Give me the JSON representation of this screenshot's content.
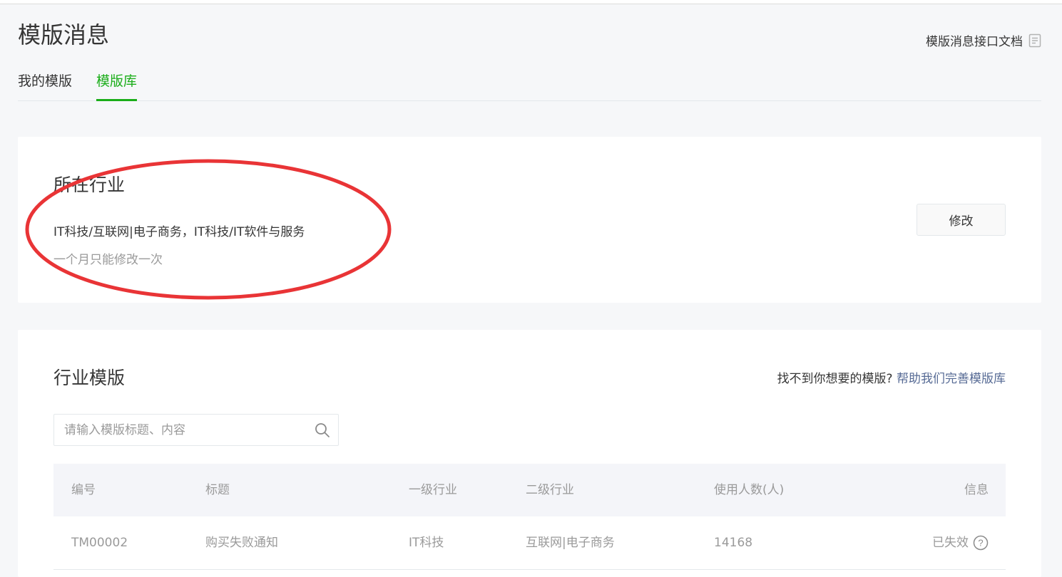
{
  "header": {
    "title": "模版消息",
    "doc_link": "模版消息接口文档"
  },
  "tabs": [
    {
      "label": "我的模版",
      "active": false
    },
    {
      "label": "模版库",
      "active": true
    }
  ],
  "industry": {
    "title": "所在行业",
    "value": "IT科技/互联网|电子商务，IT科技/IT软件与服务",
    "note": "一个月只能修改一次",
    "modify_label": "修改"
  },
  "templates": {
    "title": "行业模版",
    "help_prefix": "找不到你想要的模版?",
    "help_link": "帮助我们完善模版库",
    "search_placeholder": "请输入模版标题、内容",
    "columns": [
      "编号",
      "标题",
      "一级行业",
      "二级行业",
      "使用人数(人)",
      "信息"
    ],
    "rows": [
      {
        "id": "TM00002",
        "title": "购买失败通知",
        "industry1": "IT科技",
        "industry2": "互联网|电子商务",
        "users": "14168",
        "info": "已失效"
      }
    ]
  },
  "colors": {
    "accent": "#1aad19",
    "link": "#576b95",
    "annotation": "#e93436"
  }
}
